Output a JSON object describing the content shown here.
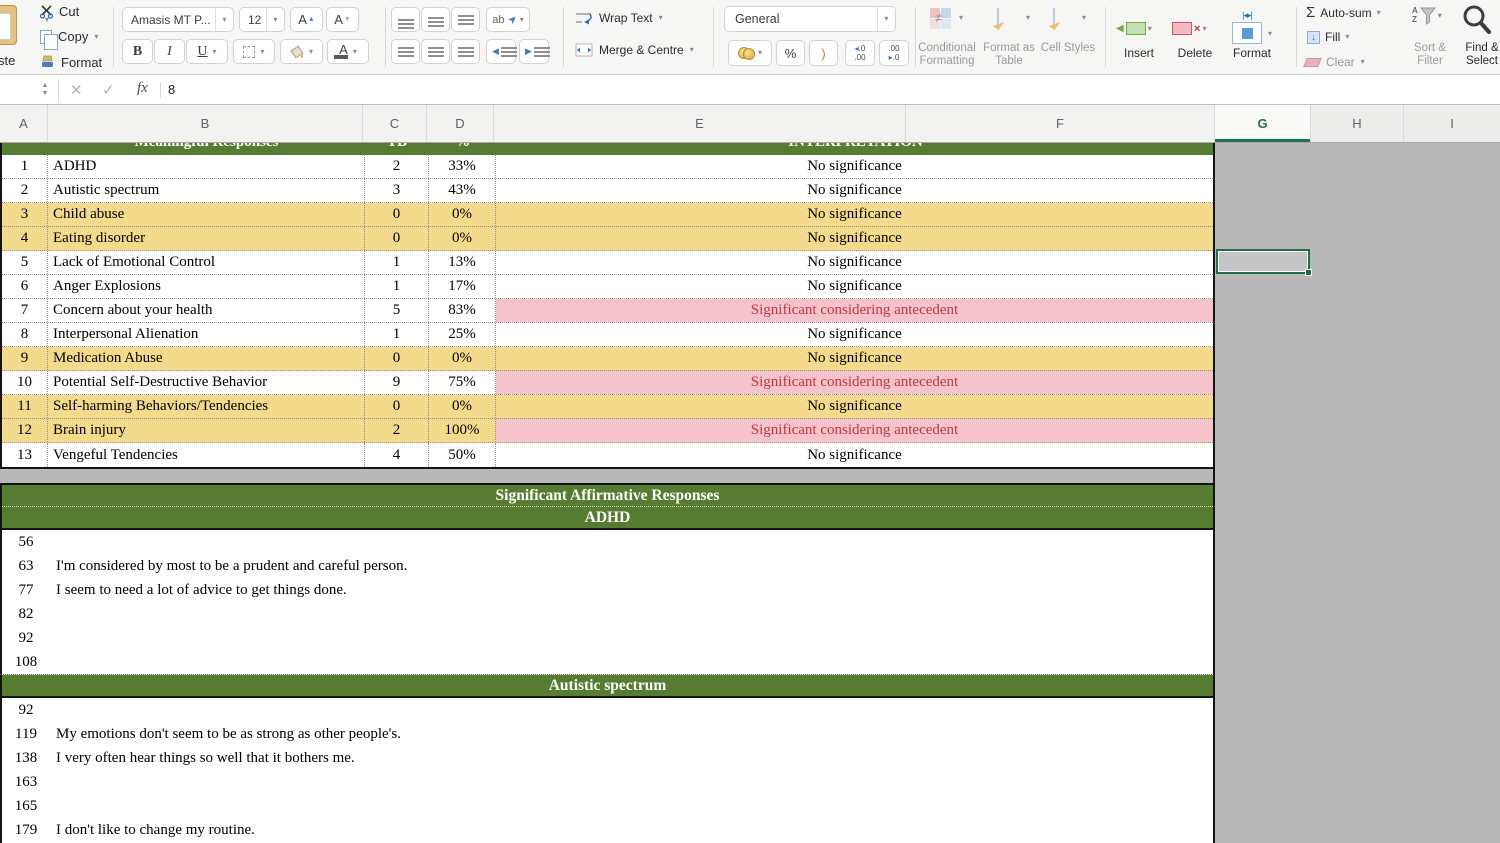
{
  "colors": {
    "header_green": "#567c31",
    "row_yellow": "#f4da8c",
    "row_pink": "#f5c3cb",
    "red_text": "#c03844",
    "selection_green": "#1e6f46",
    "outside_gray": "#b9b9b9"
  },
  "ribbon": {
    "paste_partial": "ste",
    "cut": "Cut",
    "copy": "Copy",
    "format_painter": "Format",
    "font_name": "Amasis MT P...",
    "font_size": "12",
    "bold": "B",
    "italic": "I",
    "underline": "U",
    "grow_font": "A",
    "shrink_font": "A",
    "orientation": "ab",
    "wrap_text": "Wrap Text",
    "merge_centre": "Merge & Centre",
    "number_format": "General",
    "percent": "%",
    "paren": ")",
    "inc_dec_top": ".0",
    "inc_dec_bot": ".00",
    "dec_dec_top": ".00",
    "dec_dec_bot": ".0",
    "conditional_formatting": "Conditional Formatting",
    "format_as_table": "Format as Table",
    "cell_styles": "Cell Styles",
    "insert": "Insert",
    "delete": "Delete",
    "format_cells": "Format",
    "autosum": "Auto-sum",
    "fill": "Fill",
    "clear": "Clear",
    "sort_filter": "Sort & Filter",
    "find_select": "Find & Select"
  },
  "formula_bar": {
    "fx": "fx",
    "value": "8"
  },
  "columns": [
    "A",
    "B",
    "C",
    "D",
    "E",
    "F",
    "G",
    "H",
    "I"
  ],
  "top_table": {
    "header": {
      "title": "Meaningful Responses",
      "tb": "TB",
      "pct": "%",
      "interp": "INTERPRETATION"
    },
    "rows": [
      {
        "num": "1",
        "label": "ADHD",
        "tb": "2",
        "pct": "33%",
        "interp": "No significance",
        "row_bg": "white",
        "interp_bg": "white",
        "interp_color": "black"
      },
      {
        "num": "2",
        "label": "Autistic spectrum",
        "tb": "3",
        "pct": "43%",
        "interp": "No significance",
        "row_bg": "white",
        "interp_bg": "white",
        "interp_color": "black"
      },
      {
        "num": "3",
        "label": "Child abuse",
        "tb": "0",
        "pct": "0%",
        "interp": "No significance",
        "row_bg": "yellow",
        "interp_bg": "yellow",
        "interp_color": "black"
      },
      {
        "num": "4",
        "label": "Eating disorder",
        "tb": "0",
        "pct": "0%",
        "interp": "No significance",
        "row_bg": "yellow",
        "interp_bg": "yellow",
        "interp_color": "black"
      },
      {
        "num": "5",
        "label": "Lack of Emotional Control",
        "tb": "1",
        "pct": "13%",
        "interp": "No significance",
        "row_bg": "white",
        "interp_bg": "white",
        "interp_color": "black"
      },
      {
        "num": "6",
        "label": "Anger Explosions",
        "tb": "1",
        "pct": "17%",
        "interp": "No significance",
        "row_bg": "white",
        "interp_bg": "white",
        "interp_color": "black"
      },
      {
        "num": "7",
        "label": "Concern about your health",
        "tb": "5",
        "pct": "83%",
        "interp": "Significant considering antecedent",
        "row_bg": "white",
        "interp_bg": "pink",
        "interp_color": "red"
      },
      {
        "num": "8",
        "label": "Interpersonal Alienation",
        "tb": "1",
        "pct": "25%",
        "interp": "No significance",
        "row_bg": "white",
        "interp_bg": "white",
        "interp_color": "black"
      },
      {
        "num": "9",
        "label": "Medication Abuse",
        "tb": "0",
        "pct": "0%",
        "interp": "No significance",
        "row_bg": "yellow",
        "interp_bg": "yellow",
        "interp_color": "black"
      },
      {
        "num": "10",
        "label": "Potential Self-Destructive Behavior",
        "tb": "9",
        "pct": "75%",
        "interp": "Significant considering antecedent",
        "row_bg": "white",
        "interp_bg": "pink",
        "interp_color": "red"
      },
      {
        "num": "11",
        "label": "Self-harming Behaviors/Tendencies",
        "tb": "0",
        "pct": "0%",
        "interp": "No significance",
        "row_bg": "yellow",
        "interp_bg": "yellow",
        "interp_color": "black"
      },
      {
        "num": "12",
        "label": "Brain injury",
        "tb": "2",
        "pct": "100%",
        "interp": "Significant considering antecedent",
        "row_bg": "yellow",
        "interp_bg": "pink",
        "interp_color": "red"
      },
      {
        "num": "13",
        "label": "Vengeful Tendencies",
        "tb": "4",
        "pct": "50%",
        "interp": "No significance",
        "row_bg": "white",
        "interp_bg": "white",
        "interp_color": "black"
      }
    ]
  },
  "sections": {
    "main_title": "Significant Affirmative Responses",
    "groups": [
      {
        "title": "ADHD",
        "items": [
          {
            "num": "56",
            "text": ""
          },
          {
            "num": "63",
            "text": "I'm considered by most to be a prudent and careful person."
          },
          {
            "num": "77",
            "text": "I seem to need a lot of advice to get things done."
          },
          {
            "num": "82",
            "text": ""
          },
          {
            "num": "92",
            "text": ""
          },
          {
            "num": "108",
            "text": ""
          }
        ]
      },
      {
        "title": "Autistic spectrum",
        "items": [
          {
            "num": "92",
            "text": ""
          },
          {
            "num": "119",
            "text": "My emotions don't seem to be as strong as other people's."
          },
          {
            "num": "138",
            "text": "I very often hear things so well that it bothers me."
          },
          {
            "num": "163",
            "text": ""
          },
          {
            "num": "165",
            "text": ""
          },
          {
            "num": "179",
            "text": "I don't like to change my routine."
          }
        ]
      }
    ]
  }
}
